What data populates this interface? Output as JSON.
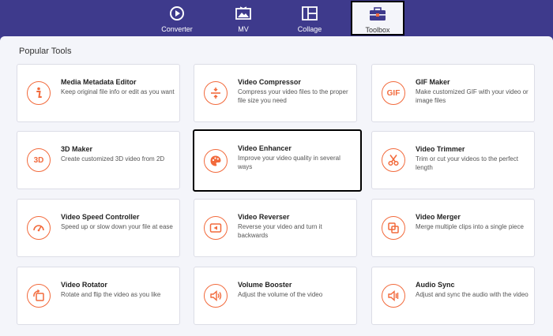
{
  "nav": {
    "tabs": [
      {
        "label": "Converter",
        "icon": "converter-icon"
      },
      {
        "label": "MV",
        "icon": "mv-icon"
      },
      {
        "label": "Collage",
        "icon": "collage-icon"
      },
      {
        "label": "Toolbox",
        "icon": "toolbox-icon",
        "active": true
      }
    ]
  },
  "section": {
    "title": "Popular Tools"
  },
  "tools": [
    {
      "title": "Media Metadata Editor",
      "desc": "Keep original file info or edit as you want",
      "icon": "info-icon"
    },
    {
      "title": "Video Compressor",
      "desc": "Compress your video files to the proper file size you need",
      "icon": "compress-icon"
    },
    {
      "title": "GIF Maker",
      "desc": "Make customized GIF with your video or image files",
      "icon": "gif-icon"
    },
    {
      "title": "3D Maker",
      "desc": "Create customized 3D video from 2D",
      "icon": "3d-icon"
    },
    {
      "title": "Video Enhancer",
      "desc": "Improve your video quality in several ways",
      "icon": "palette-icon"
    },
    {
      "title": "Video Trimmer",
      "desc": "Trim or cut your videos to the perfect length",
      "icon": "scissors-icon"
    },
    {
      "title": "Video Speed Controller",
      "desc": "Speed up or slow down your file at ease",
      "icon": "speedometer-icon"
    },
    {
      "title": "Video Reverser",
      "desc": "Reverse your video and turn it backwards",
      "icon": "rewind-icon"
    },
    {
      "title": "Video Merger",
      "desc": "Merge multiple clips into a single piece",
      "icon": "merge-icon"
    },
    {
      "title": "Video Rotator",
      "desc": "Rotate and flip the video as you like",
      "icon": "rotate-icon"
    },
    {
      "title": "Volume Booster",
      "desc": "Adjust the volume of the video",
      "icon": "volume-icon"
    },
    {
      "title": "Audio Sync",
      "desc": "Adjust and sync the audio with the video",
      "icon": "audio-sync-icon"
    }
  ],
  "icon_glyphs": {
    "gif": "GIF",
    "3d": "3D"
  },
  "colors": {
    "accent": "#f26a3c",
    "topbar": "#3e3a8c",
    "panel": "#f4f5fa"
  }
}
